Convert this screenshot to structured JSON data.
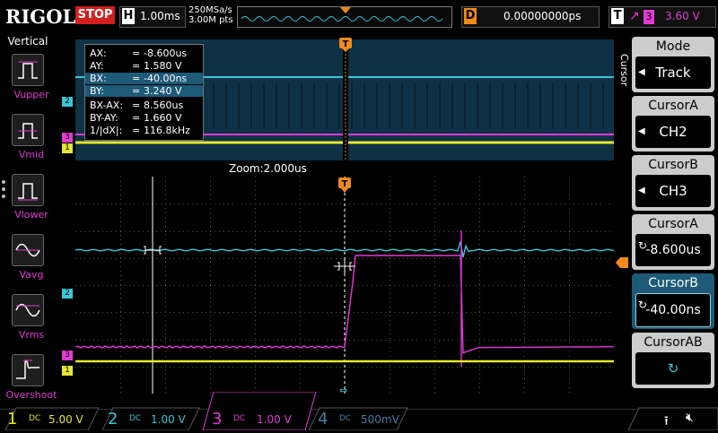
{
  "brand": "RIGOL",
  "status": "STOP",
  "horizontal": {
    "label": "H",
    "value": "1.00ms"
  },
  "sample": {
    "rate": "250MSa/s",
    "points": "3.00M pts"
  },
  "delay": {
    "label": "D",
    "value": "0.00000000ps"
  },
  "trigger": {
    "label": "T",
    "slope_icon": "rising-edge-icon",
    "source": "3",
    "level": "3.60 V"
  },
  "vertical_panel": {
    "title": "Vertical",
    "items": [
      {
        "label": "Vupper",
        "icon": "vupper-icon"
      },
      {
        "label": "Vmid",
        "icon": "vmid-icon"
      },
      {
        "label": "Vlower",
        "icon": "vlower-icon"
      },
      {
        "label": "Vavg",
        "icon": "vavg-icon"
      },
      {
        "label": "Vrms",
        "icon": "vrms-icon"
      },
      {
        "label": "Overshoot",
        "icon": "overshoot-icon"
      }
    ]
  },
  "readout": [
    {
      "k": "AX:",
      "v": "-8.600us"
    },
    {
      "k": "AY:",
      "v": "1.580 V"
    },
    {
      "k": "BX:",
      "v": "-40.00ns"
    },
    {
      "k": "BY:",
      "v": "3.240 V"
    },
    {
      "k": "BX-AX:",
      "v": "8.560us"
    },
    {
      "k": "BY-AY:",
      "v": "1.660 V"
    },
    {
      "k": "1/|dX|:",
      "v": "116.8kHz"
    }
  ],
  "readout_eq": "=",
  "zoom_label": "Zoom:2.000us",
  "cursor_menu": {
    "side_label": "Cursor",
    "mode": {
      "title": "Mode",
      "value": "Track"
    },
    "cursorA_src": {
      "title": "CursorA",
      "value": "CH2"
    },
    "cursorB_src": {
      "title": "CursorB",
      "value": "CH3"
    },
    "cursorA_pos": {
      "title": "CursorA",
      "value": "-8.600us"
    },
    "cursorB_pos": {
      "title": "CursorB",
      "value": "-40.00ns"
    },
    "cursorAB": {
      "title": "CursorAB"
    }
  },
  "channel_markers": {
    "ch1": "1",
    "ch2": "2",
    "ch3": "3",
    "trigger": "T"
  },
  "channels": [
    {
      "num": "1",
      "coupling": "DC",
      "scale": "5.00 V",
      "color": "#e6e62e"
    },
    {
      "num": "2",
      "coupling": "DC",
      "scale": "1.00 V",
      "color": "#39c6d6"
    },
    {
      "num": "3",
      "coupling": "DC",
      "scale": "1.00 V",
      "color": "#e23ad6"
    },
    {
      "num": "4",
      "coupling": "DC",
      "scale": "500mV",
      "color": "#4b7c9c"
    }
  ],
  "colors": {
    "ch1": "#e6e62e",
    "ch2": "#39c6d6",
    "ch3": "#e23ad6",
    "trigger": "#f08a1c",
    "menu_active": "#1c5a78"
  }
}
